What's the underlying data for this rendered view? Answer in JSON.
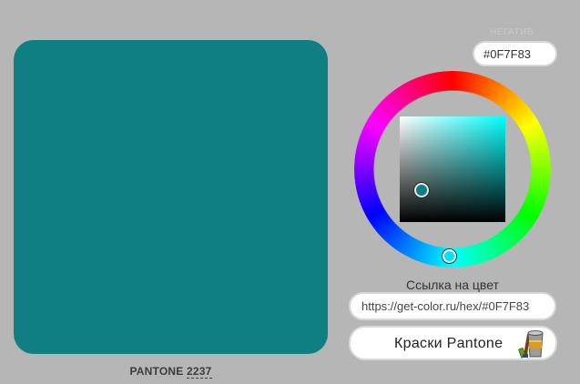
{
  "color": {
    "hex": "#0F7F83",
    "negative_label": "НЕГАТИВ"
  },
  "pantone": {
    "prefix": "PANTONE",
    "code": "2237"
  },
  "picker": {
    "hue_icon": "hue-wheel-icon",
    "sv_icon": "saturation-value-square"
  },
  "link": {
    "label": "Ссылка на цвет",
    "url": "https://get-color.ru/hex/#0F7F83"
  },
  "paints": {
    "label": "Краски Pantone",
    "icon": "paint-bucket-icon"
  }
}
